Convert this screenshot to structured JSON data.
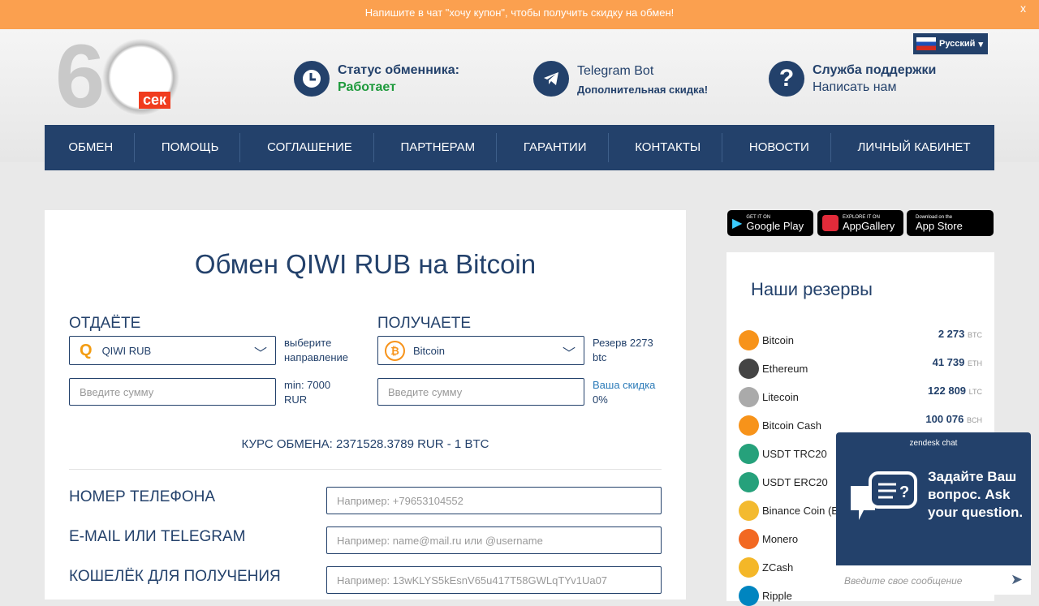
{
  "banner": {
    "text": "Напишите в чат \"хочу купон\", чтобы получить скидку на обмен!",
    "close": "x"
  },
  "logo": {
    "number": "60",
    "unit": "сек"
  },
  "language": "Русский",
  "status": {
    "title": "Статус обменника:",
    "value": "Работает"
  },
  "telegram": {
    "title": "Telegram Bot",
    "sub": "Дополнительная скидка!"
  },
  "support": {
    "title": "Служба поддержки",
    "sub": "Написать нам"
  },
  "nav": [
    "ОБМЕН",
    "ПОМОЩЬ",
    "СОГЛАШЕНИЕ",
    "ПАРТНЕРАМ",
    "ГАРАНТИИ",
    "КОНТАКТЫ",
    "НОВОСТИ",
    "ЛИЧНЫЙ КАБИНЕТ"
  ],
  "exchange": {
    "title": "Обмен QIWI RUB на Bitcoin",
    "give_label": "ОТДАЁТЕ",
    "get_label": "ПОЛУЧАЕТЕ",
    "give_currency": "QIWI RUB",
    "get_currency": "Bitcoin",
    "give_note": "выберите направление",
    "get_note": "Резерв 2273 btc",
    "amount_placeholder": "Введите сумму",
    "min_note": "min: 7000 RUR",
    "discount_link": "Ваша скидка",
    "discount_value": "0%",
    "rate": "КУРС ОБМЕНА: 2371528.3789 RUR - 1 BTC",
    "fields": [
      {
        "label": "НОМЕР ТЕЛЕФОНА",
        "placeholder": "Например: +79653104552"
      },
      {
        "label": "E-MAIL ИЛИ TELEGRAM",
        "placeholder": "Например: name@mail.ru или @username"
      },
      {
        "label": "КОШЕЛЁК ДЛЯ ПОЛУЧЕНИЯ",
        "placeholder": "Например: 13wKLYS5kEsnV65u417T58GWLqTYv1Ua07"
      }
    ]
  },
  "apps": [
    {
      "small": "GET IT ON",
      "big": "Google Play"
    },
    {
      "small": "EXPLORE IT ON",
      "big": "AppGallery"
    },
    {
      "small": "Download on the",
      "big": "App Store"
    }
  ],
  "reserves": {
    "title": "Наши резервы",
    "items": [
      {
        "name": "Bitcoin",
        "amount": "2 273",
        "unit": "BTC",
        "color": "#f7931a"
      },
      {
        "name": "Ethereum",
        "amount": "41 739",
        "unit": "ETH",
        "color": "#444"
      },
      {
        "name": "Litecoin",
        "amount": "122 809",
        "unit": "LTC",
        "color": "#aaa"
      },
      {
        "name": "Bitcoin Cash",
        "amount": "100 076",
        "unit": "BCH",
        "color": "#f7931a"
      },
      {
        "name": "USDT TRC20",
        "color": "#26a17b"
      },
      {
        "name": "USDT ERC20",
        "color": "#26a17b"
      },
      {
        "name": "Binance Coin (B",
        "color": "#f3ba2f"
      },
      {
        "name": "Monero",
        "color": "#f26822"
      },
      {
        "name": "ZCash",
        "color": "#f4b728"
      },
      {
        "name": "Ripple",
        "color": "#0085c0"
      }
    ]
  },
  "chat": {
    "header": "zendesk chat",
    "message": "Задайте Ваш вопрос. Ask your question.",
    "placeholder": "Введите свое сообщение"
  }
}
